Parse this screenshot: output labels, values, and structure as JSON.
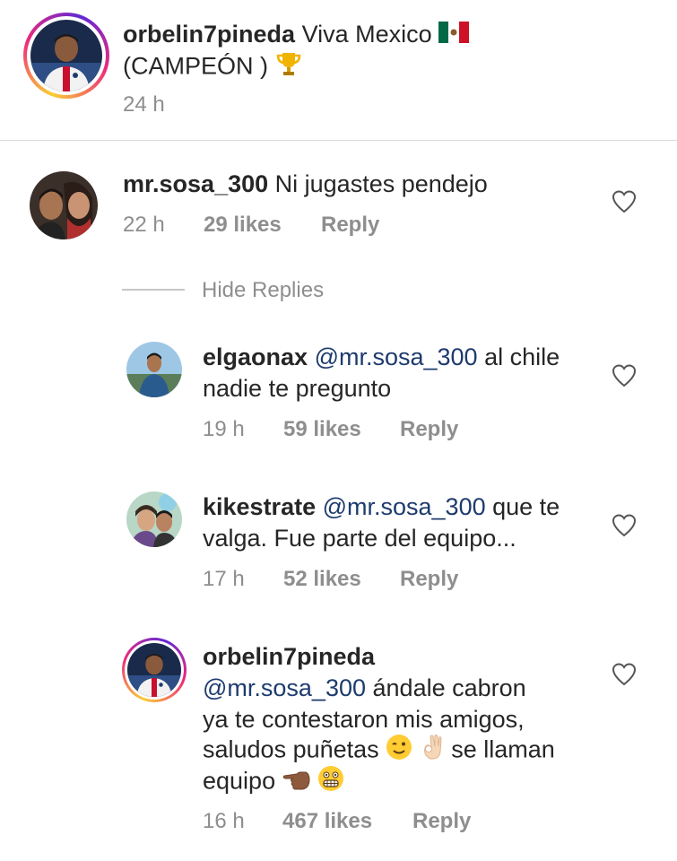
{
  "post": {
    "username": "orbelin7pineda",
    "caption_line1": "Viva Mexico",
    "caption_line2": "(CAMPEÓN )",
    "time": "24 h"
  },
  "comment": {
    "username": "mr.sosa_300",
    "text": "Ni jugastes pendejo",
    "time": "22 h",
    "likes": "29 likes",
    "reply": "Reply"
  },
  "hide_replies": "Hide Replies",
  "replies": [
    {
      "username": "elgaonax",
      "mention": "@mr.sosa_300",
      "line1": "al chile",
      "line2": "nadie te pregunto",
      "time": "19 h",
      "likes": "59 likes",
      "reply": "Reply"
    },
    {
      "username": "kikestrate",
      "mention": "@mr.sosa_300",
      "line1": "que te",
      "line2": "valga. Fue parte del equipo...",
      "time": "17 h",
      "likes": "52 likes",
      "reply": "Reply"
    },
    {
      "username": "orbelin7pineda",
      "mention": "@mr.sosa_300",
      "line1": "ándale cabron",
      "line2": "ya te contestaron mis amigos,",
      "line3a": "saludos puñetas",
      "line3b": "se llaman",
      "line4": "equipo",
      "time": "16 h",
      "likes": "467 likes",
      "reply": "Reply"
    }
  ],
  "icons": {
    "heart": "heart-outline-icon",
    "flag": "mexico-flag-icon",
    "trophy": "trophy-icon",
    "wink": "winking-face-icon",
    "ok": "ok-hand-icon",
    "point": "backhand-index-pointing-left-icon",
    "grimace": "grimacing-face-icon"
  },
  "colors": {
    "text": "#262626",
    "meta": "#8e8e8e",
    "mention": "#1d3b6e",
    "divider": "#dbdbdb"
  }
}
